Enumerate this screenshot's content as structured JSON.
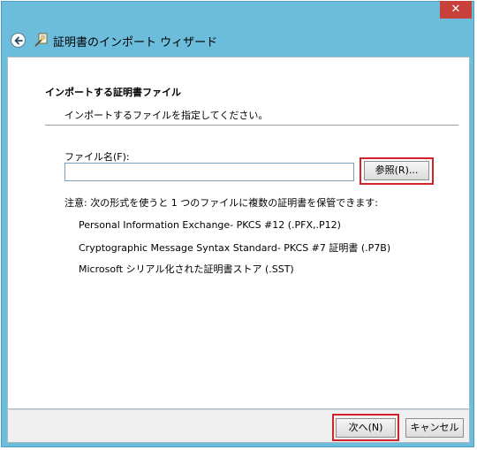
{
  "window": {
    "close_label": "✕",
    "title": "証明書のインポート ウィザード"
  },
  "page": {
    "section_title": "インポートする証明書ファイル",
    "section_desc": "インポートするファイルを指定してください。",
    "filename_label": "ファイル名(F):",
    "filename_value": "",
    "browse_label": "参照(R)...",
    "note": "注意: 次の形式を使うと 1 つのファイルに複数の証明書を保管できます:",
    "formats": [
      "Personal Information Exchange- PKCS #12 (.PFX,.P12)",
      "Cryptographic Message Syntax Standard- PKCS #7 証明書 (.P7B)",
      "Microsoft シリアル化された証明書ストア (.SST)"
    ]
  },
  "footer": {
    "next_label": "次へ(N)",
    "cancel_label": "キャンセル"
  },
  "colors": {
    "titlebar": "#6cbddb",
    "close": "#c7403a",
    "highlight": "#d2232a"
  },
  "icons": [
    "back-arrow-icon",
    "certificate-wizard-icon",
    "close-icon"
  ]
}
